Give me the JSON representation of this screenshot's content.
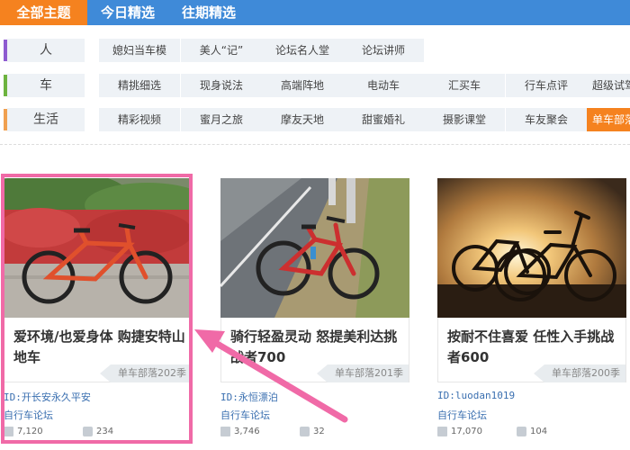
{
  "nav": {
    "tabs": [
      "全部主题",
      "今日精选",
      "往期精选"
    ]
  },
  "categories": [
    {
      "label": "人",
      "color": "#8e5bd0",
      "tags": [
        "媳妇当车模",
        "美人“记”",
        "论坛名人堂",
        "论坛讲师"
      ]
    },
    {
      "label": "车",
      "color": "#6db33f",
      "tags": [
        "精挑细选",
        "现身说法",
        "高端阵地",
        "电动车",
        "汇买车",
        "行车点评",
        "超级试驾"
      ]
    },
    {
      "label": "生活",
      "color": "#f0a050",
      "tags": [
        "精彩视频",
        "蜜月之旅",
        "摩友天地",
        "甜蜜婚礼",
        "摄影课堂",
        "车友聚会",
        "单车部落"
      ]
    }
  ],
  "cards": [
    {
      "title": "爱环境/也爱身体 购捷安特山地车",
      "season": "单车部落202季",
      "user_id": "ID:开长安永久平安",
      "forum": "自行车论坛",
      "views": "7,120",
      "comments": "234"
    },
    {
      "title": "骑行轻盈灵动 怒提美利达挑战者700",
      "season": "单车部落201季",
      "user_id": "ID:永恒漂泊",
      "forum": "自行车论坛",
      "views": "3,746",
      "comments": "32"
    },
    {
      "title": "按耐不住喜爱 任性入手挑战者600",
      "season": "单车部落200季",
      "user_id": "ID:luodan1019",
      "forum": "自行车论坛",
      "views": "17,070",
      "comments": "104"
    }
  ],
  "colors": {
    "nav": "#3f8ad8",
    "accent": "#f5821f",
    "highlight": "#f06aa7",
    "link": "#3a6fb0"
  },
  "icons": {
    "views": "views-icon",
    "comments": "comment-icon"
  }
}
